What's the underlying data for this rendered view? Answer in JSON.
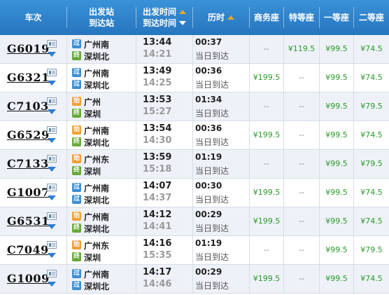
{
  "header": {
    "train_no": "车次",
    "stations_top": "出发站",
    "stations_bottom": "到达站",
    "times_top": "出发时间",
    "times_bottom": "到达时间",
    "duration": "历时",
    "business": "商务座",
    "special": "特等座",
    "first": "一等座",
    "second": "二等座"
  },
  "icons": {
    "pass": "过",
    "start": "始",
    "end": "终"
  },
  "colors": {
    "header_bg": "#2a7cc7",
    "sort_active": "#f5a623",
    "price_available": "#2a9a2a",
    "row_alt": "#eef1f8"
  },
  "rows": [
    {
      "train": "G6019",
      "from_type": "pass",
      "from": "广州南",
      "to_type": "end",
      "to": "深圳北",
      "dep": "13:44",
      "arr": "14:21",
      "dur": "00:37",
      "sameday": "当日到达",
      "business": "--",
      "special": "¥119.5",
      "first": "¥99.5",
      "second": "¥74.5"
    },
    {
      "train": "G6321",
      "from_type": "pass",
      "from": "广州南",
      "to_type": "pass",
      "to": "深圳北",
      "dep": "13:49",
      "arr": "14:25",
      "dur": "00:36",
      "sameday": "当日到达",
      "business": "¥199.5",
      "special": "--",
      "first": "¥99.5",
      "second": "¥74.5"
    },
    {
      "train": "C7103",
      "from_type": "start",
      "from": "广州",
      "to_type": "end",
      "to": "深圳",
      "dep": "13:53",
      "arr": "15:27",
      "dur": "01:34",
      "sameday": "当日到达",
      "business": "--",
      "special": "--",
      "first": "¥99.5",
      "second": "¥79.5"
    },
    {
      "train": "G6529",
      "from_type": "start",
      "from": "广州南",
      "to_type": "end",
      "to": "深圳北",
      "dep": "13:54",
      "arr": "14:30",
      "dur": "00:36",
      "sameday": "当日到达",
      "business": "¥199.5",
      "special": "--",
      "first": "¥99.5",
      "second": "¥74.5"
    },
    {
      "train": "C7133",
      "from_type": "start",
      "from": "广州东",
      "to_type": "end",
      "to": "深圳",
      "dep": "13:59",
      "arr": "15:18",
      "dur": "01:19",
      "sameday": "当日到达",
      "business": "--",
      "special": "--",
      "first": "¥99.5",
      "second": "¥79.5"
    },
    {
      "train": "G1007",
      "from_type": "pass",
      "from": "广州南",
      "to_type": "pass",
      "to": "深圳北",
      "dep": "14:07",
      "arr": "14:37",
      "dur": "00:30",
      "sameday": "当日到达",
      "business": "¥199.5",
      "special": "--",
      "first": "¥99.5",
      "second": "¥74.5"
    },
    {
      "train": "G6531",
      "from_type": "start",
      "from": "广州南",
      "to_type": "end",
      "to": "深圳北",
      "dep": "14:12",
      "arr": "14:41",
      "dur": "00:29",
      "sameday": "当日到达",
      "business": "¥199.5",
      "special": "--",
      "first": "¥99.5",
      "second": "¥74.5"
    },
    {
      "train": "C7049",
      "from_type": "start",
      "from": "广州东",
      "to_type": "end",
      "to": "深圳",
      "dep": "14:16",
      "arr": "15:35",
      "dur": "01:19",
      "sameday": "当日到达",
      "business": "--",
      "special": "--",
      "first": "¥99.5",
      "second": "¥79.5"
    },
    {
      "train": "G1009",
      "from_type": "pass",
      "from": "广州南",
      "to_type": "pass",
      "to": "深圳北",
      "dep": "14:17",
      "arr": "14:46",
      "dur": "00:29",
      "sameday": "当日到达",
      "business": "¥199.5",
      "special": "--",
      "first": "¥99.5",
      "second": "¥74.5"
    }
  ]
}
